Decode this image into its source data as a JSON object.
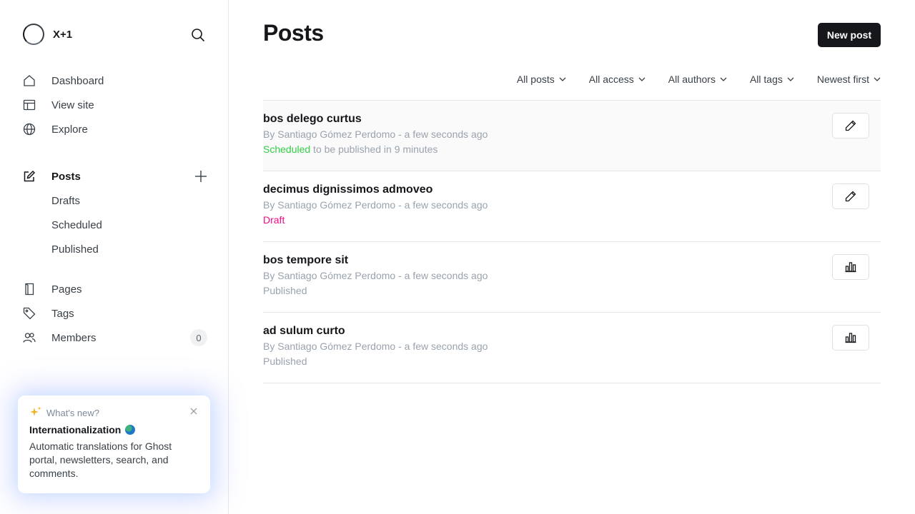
{
  "sidebar": {
    "brand": {
      "name": "X+1"
    },
    "nav_primary": [
      {
        "label": "Dashboard",
        "icon": "home-icon"
      },
      {
        "label": "View site",
        "icon": "layout-icon"
      },
      {
        "label": "Explore",
        "icon": "globe-icon"
      }
    ],
    "posts": {
      "label": "Posts",
      "icon": "edit-icon",
      "sub": [
        "Drafts",
        "Scheduled",
        "Published"
      ]
    },
    "nav_secondary": [
      {
        "label": "Pages",
        "icon": "page-icon"
      },
      {
        "label": "Tags",
        "icon": "tag-icon"
      },
      {
        "label": "Members",
        "icon": "members-icon",
        "count": "0"
      }
    ],
    "whats_new": {
      "heading": "What's new?",
      "title": "Internationalization",
      "description": "Automatic translations for Ghost portal, newsletters, search, and comments."
    }
  },
  "main": {
    "title": "Posts",
    "new_post_label": "New post",
    "filters": [
      "All posts",
      "All access",
      "All authors",
      "All tags",
      "Newest first"
    ],
    "posts": [
      {
        "title": "bos delego curtus",
        "meta": "By Santiago Gómez Perdomo - a few seconds ago",
        "status": "Scheduled",
        "status_extra": " to be published in 9 minutes",
        "action": "edit"
      },
      {
        "title": "decimus dignissimos admoveo",
        "meta": "By Santiago Gómez Perdomo - a few seconds ago",
        "status": "Draft",
        "status_extra": "",
        "action": "edit"
      },
      {
        "title": "bos tempore sit",
        "meta": "By Santiago Gómez Perdomo - a few seconds ago",
        "status": "Published",
        "status_extra": "",
        "action": "analytics"
      },
      {
        "title": "ad sulum curto",
        "meta": "By Santiago Gómez Perdomo - a few seconds ago",
        "status": "Published",
        "status_extra": "",
        "action": "analytics"
      }
    ]
  },
  "colors": {
    "scheduled": "#30cf43",
    "draft": "#f50b86",
    "published": "#99a3ad",
    "primary_button": "#15171a"
  }
}
